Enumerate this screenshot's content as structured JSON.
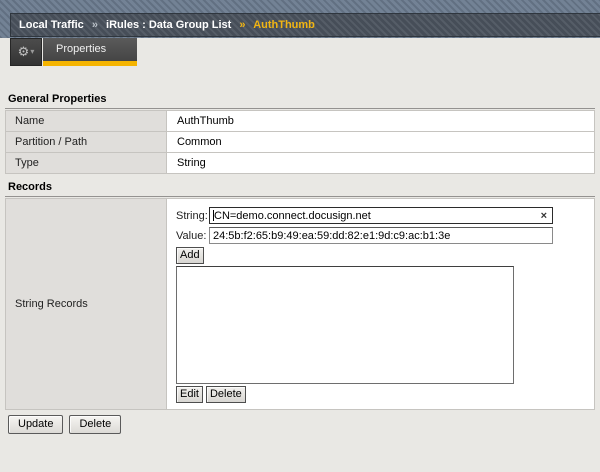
{
  "breadcrumb": {
    "separator": "»",
    "items": [
      "Local Traffic",
      "iRules : Data Group List",
      "AuthThumb"
    ]
  },
  "icons": {
    "gear": "⚙",
    "caret_down": "▾",
    "clear": "×"
  },
  "tabs": {
    "properties_label": "Properties"
  },
  "sections": {
    "general": {
      "title": "General Properties",
      "rows": [
        {
          "label": "Name",
          "value": "AuthThumb"
        },
        {
          "label": "Partition / Path",
          "value": "Common"
        },
        {
          "label": "Type",
          "value": "String"
        }
      ]
    },
    "records": {
      "title": "Records",
      "row_label": "String Records",
      "string_label": "String:",
      "string_value": "CN=demo.connect.docusign.net",
      "value_label": "Value:",
      "value_value": "24:5b:f2:65:b9:49:ea:59:dd:82:e1:9d:c9:ac:b1:3e",
      "add_label": "Add",
      "edit_label": "Edit",
      "delete_label": "Delete",
      "listbox_items": []
    }
  },
  "footer": {
    "update_label": "Update",
    "delete_label": "Delete"
  },
  "colors": {
    "accent_gold": "#f5b400",
    "breadcrumb_gold": "#f1b513",
    "header_slate": "#4c545f",
    "header_light_slate": "#6d7d91",
    "tab_dark": "#4a4a4a",
    "label_cell_bg": "#e0dedb",
    "page_bg": "#e9e8e4"
  }
}
